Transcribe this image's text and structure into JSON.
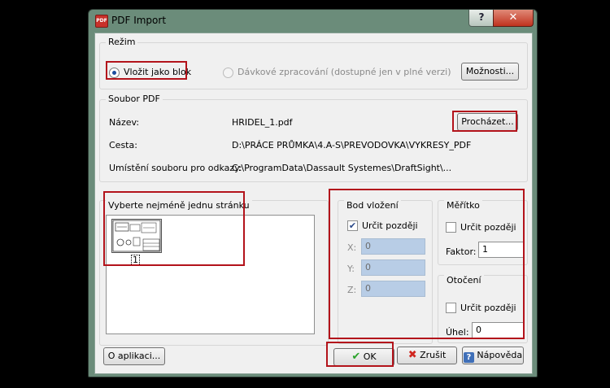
{
  "window": {
    "title": "PDF Import",
    "title_icon": "pdf-icon",
    "help_label": "?",
    "close_label": "✕"
  },
  "mode": {
    "label": "Režim",
    "insert_block": "Vložit jako blok",
    "batch": "Dávkové zpracování (dostupné jen v plné verzi)",
    "options_button": "Možnosti..."
  },
  "pdf_file": {
    "label": "Soubor PDF",
    "name_label": "Název:",
    "name_value": "HRIDEL_1.pdf",
    "browse_button": "Procházet...",
    "path_label": "Cesta:",
    "path_value": "D:\\PRÁCE PRŮMKA\\4.A-S\\PREVODOVKA\\VYKRESY_PDF",
    "ref_label": "Umístění souboru pro odkazy:",
    "ref_value": "C:\\ProgramData\\Dassault Systemes\\DraftSight\\..."
  },
  "pages": {
    "label": "Vyberte nejméně jednu stránku",
    "page_number": "1"
  },
  "insertion_point": {
    "label": "Bod vložení",
    "specify_later": "Určit později",
    "x_label": "X:",
    "x_value": "0",
    "y_label": "Y:",
    "y_value": "0",
    "z_label": "Z:",
    "z_value": "0"
  },
  "scale": {
    "label": "Měřítko",
    "specify_later": "Určit později",
    "factor_label": "Faktor:",
    "factor_value": "1"
  },
  "rotation": {
    "label": "Otočení",
    "specify_later": "Určit později",
    "angle_label": "Úhel:",
    "angle_value": "0"
  },
  "footer": {
    "about_button": "O aplikaci...",
    "ok_button": "OK",
    "cancel_button": "Zrušit",
    "help_button": "Nápověda"
  },
  "colors": {
    "highlight": "#b3131b",
    "title_bar": "#6b8c7a",
    "dialog_bg": "#f0f0f0"
  }
}
